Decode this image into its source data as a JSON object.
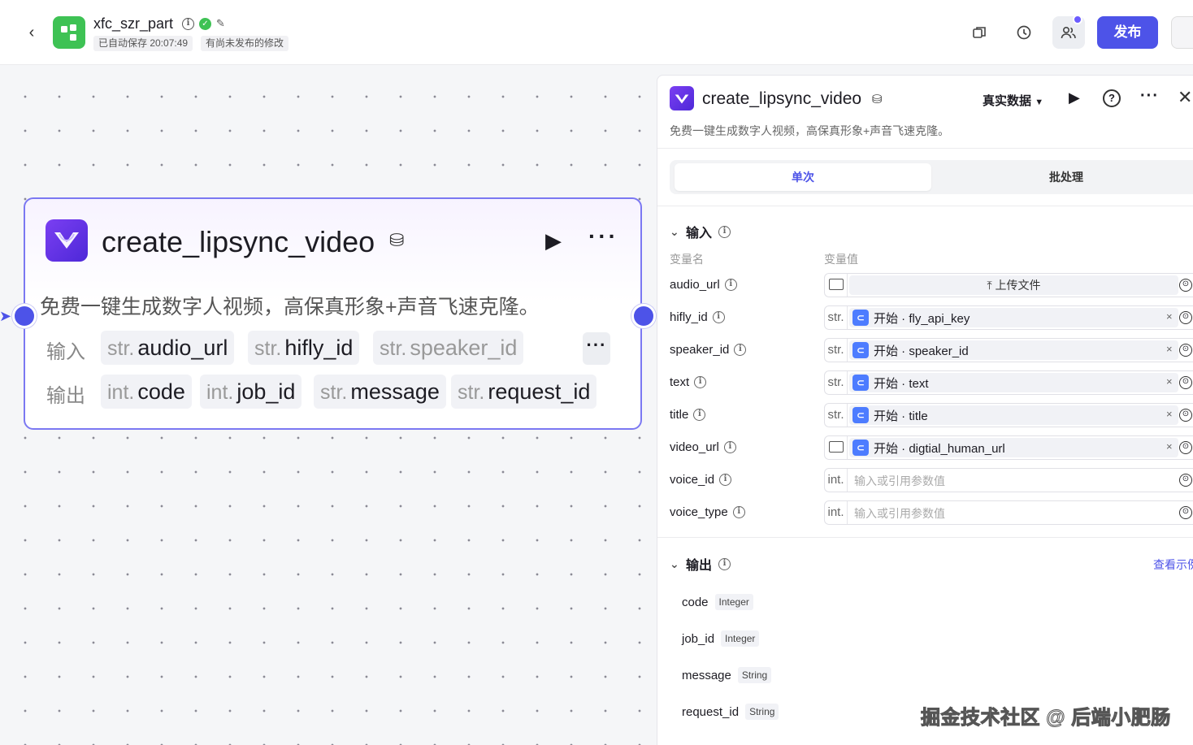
{
  "header": {
    "app_name": "xfc_szr_part",
    "autosave": "已自动保存 20:07:49",
    "unpublished": "有尚未发布的修改",
    "publish_label": "发布",
    "brand_color": "#4d53e8"
  },
  "node": {
    "title": "create_lipsync_video",
    "description": "免费一键生成数字人视频，高保真形象+声音飞速克隆。",
    "input_label": "输入",
    "output_label": "输出",
    "inputs": [
      {
        "type": "str.",
        "name": "audio_url"
      },
      {
        "type": "str.",
        "name": "hifly_id"
      },
      {
        "type": "str.",
        "name": "speaker_id"
      }
    ],
    "outputs": [
      {
        "type": "int.",
        "name": "code"
      },
      {
        "type": "int.",
        "name": "job_id"
      },
      {
        "type": "str.",
        "name": "message"
      },
      {
        "type": "str.",
        "name": "request_id"
      }
    ],
    "more_label": "···"
  },
  "panel": {
    "title": "create_lipsync_video",
    "mode": "真实数据",
    "description": "免费一键生成数字人视频，高保真形象+声音飞速克隆。",
    "tabs": [
      "单次",
      "批处理"
    ],
    "input_section": "输入",
    "col_name": "变量名",
    "col_value": "变量值",
    "upload_label": "上传文件",
    "placeholder": "输入或引用参数值",
    "params": [
      {
        "name": "audio_url",
        "type": "",
        "value": ""
      },
      {
        "name": "hifly_id",
        "type": "str.",
        "value": "开始 · fly_api_key"
      },
      {
        "name": "speaker_id",
        "type": "str.",
        "value": "开始 · speaker_id"
      },
      {
        "name": "text",
        "type": "str.",
        "value": "开始 · text"
      },
      {
        "name": "title",
        "type": "str.",
        "value": "开始 · title"
      },
      {
        "name": "video_url",
        "type": "",
        "value": "开始 · digtial_human_url"
      },
      {
        "name": "voice_id",
        "type": "int.",
        "value": ""
      },
      {
        "name": "voice_type",
        "type": "int.",
        "value": ""
      }
    ],
    "output_section": "输出",
    "view_example": "查看示例",
    "outputs": [
      {
        "name": "code",
        "type": "Integer"
      },
      {
        "name": "job_id",
        "type": "Integer"
      },
      {
        "name": "message",
        "type": "String"
      },
      {
        "name": "request_id",
        "type": "String"
      }
    ]
  },
  "watermark": "掘金技术社区 @ 后端小肥肠"
}
